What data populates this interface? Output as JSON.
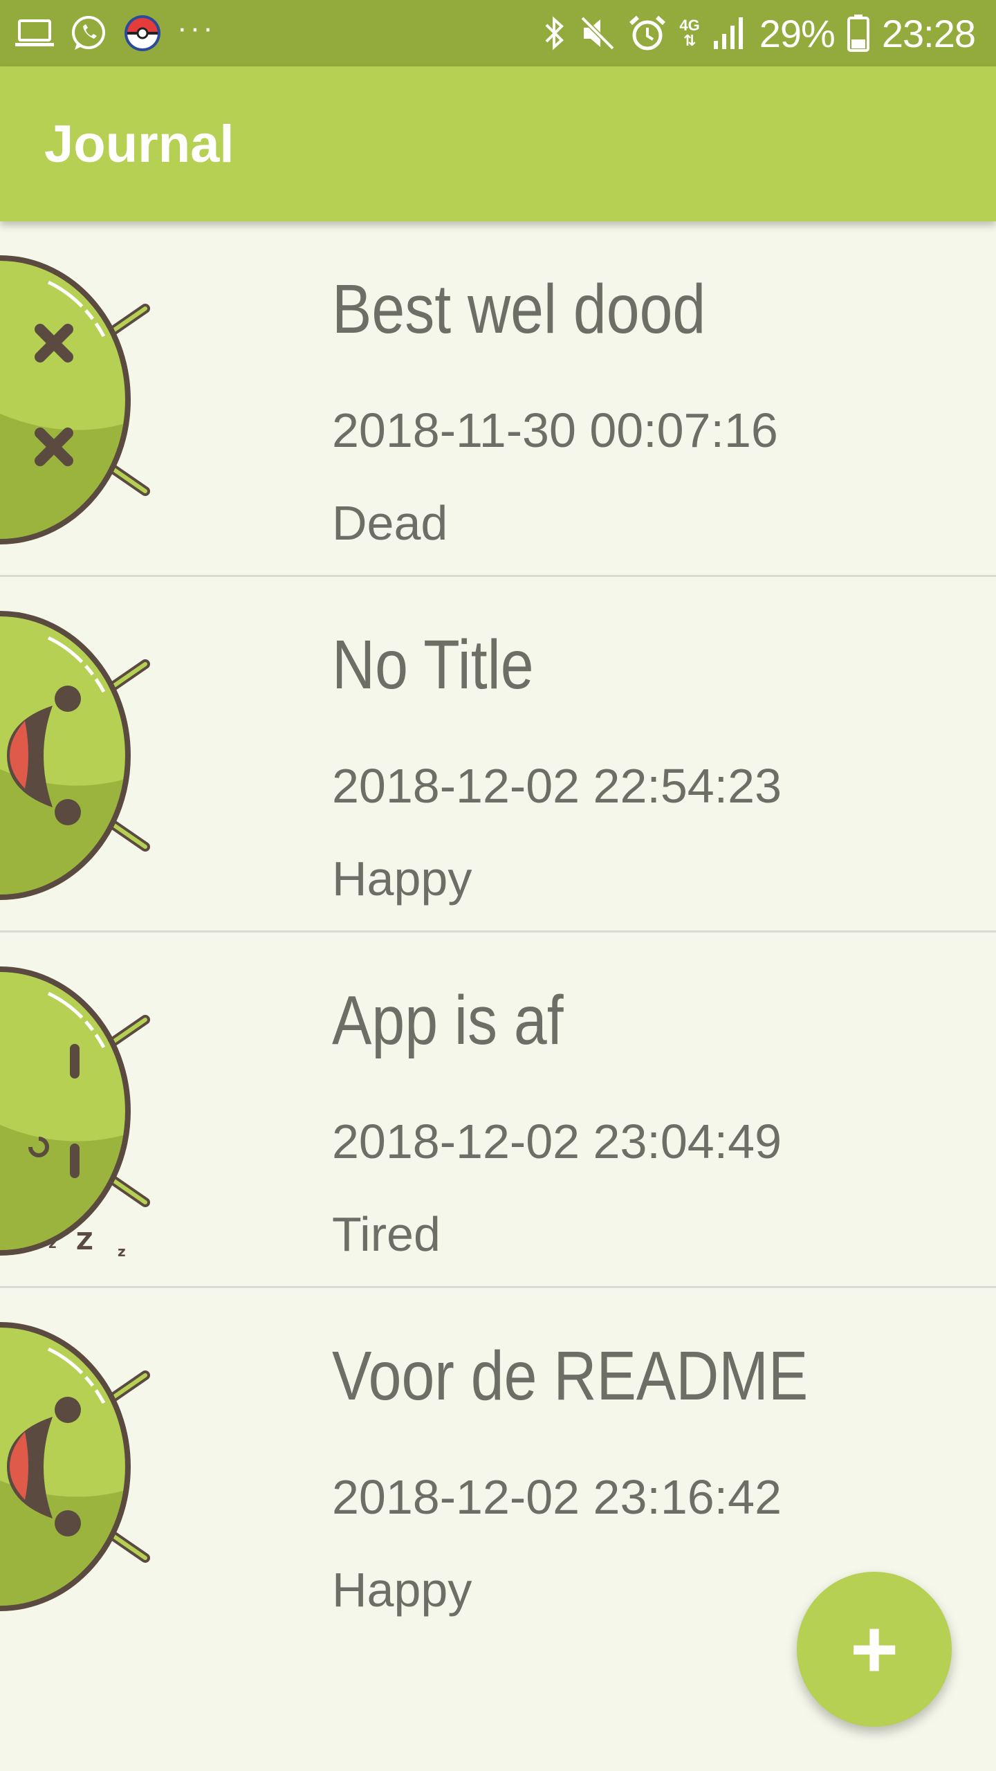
{
  "status_bar": {
    "battery": "29%",
    "time": "23:28",
    "network": "4G",
    "left_icons": [
      "laptop-icon",
      "whatsapp-icon",
      "pokeball-icon",
      "more-dots-icon"
    ],
    "right_icons": [
      "bluetooth-icon",
      "mute-icon",
      "alarm-icon",
      "network-4g-icon",
      "signal-icon",
      "battery-icon"
    ]
  },
  "app_bar": {
    "title": "Journal"
  },
  "entries": [
    {
      "title": "Best wel dood",
      "date": "2018-11-30 00:07:16",
      "mood": "Dead",
      "mood_icon": "dead-android-icon"
    },
    {
      "title": "No Title",
      "date": "2018-12-02 22:54:23",
      "mood": "Happy",
      "mood_icon": "happy-android-icon"
    },
    {
      "title": "App is af",
      "date": "2018-12-02 23:04:49",
      "mood": "Tired",
      "mood_icon": "tired-android-icon"
    },
    {
      "title": "Voor de README",
      "date": "2018-12-02 23:16:42",
      "mood": "Happy",
      "mood_icon": "happy-android-icon"
    }
  ],
  "fab": {
    "label": "+"
  },
  "colors": {
    "status_bar": "#93ab3d",
    "app_bar": "#b5d052",
    "background": "#f5f7ea",
    "text": "#6d6e66",
    "android_light": "#b5d052",
    "android_dark": "#9ab43e",
    "outline": "#5a4a40",
    "mouth_red": "#e05a4a"
  }
}
